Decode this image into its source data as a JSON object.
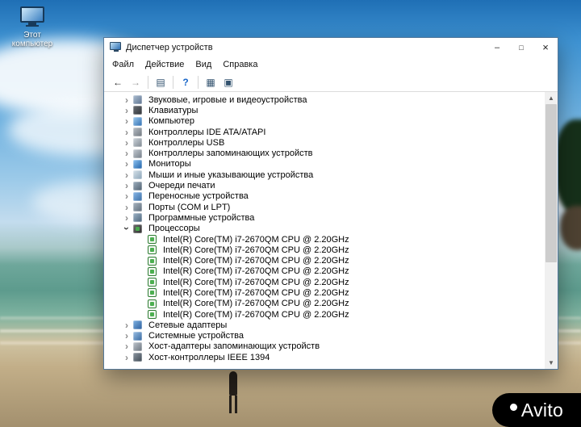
{
  "desktop": {
    "icon_label": "Этот компьютер"
  },
  "watermark": {
    "label": "Avito"
  },
  "window": {
    "title": "Диспетчер устройств",
    "controls": {
      "minimize": "–",
      "maximize": "□",
      "close": "×"
    },
    "menu": [
      "Файл",
      "Действие",
      "Вид",
      "Справка"
    ],
    "toolbar": [
      {
        "name": "back-button",
        "glyph": "←"
      },
      {
        "name": "forward-button",
        "glyph": "→"
      },
      {
        "name": "separator"
      },
      {
        "name": "show-console-tree-button",
        "glyph": "▤"
      },
      {
        "name": "separator"
      },
      {
        "name": "help-button",
        "glyph": "?"
      },
      {
        "name": "separator"
      },
      {
        "name": "properties-button",
        "glyph": "▦"
      },
      {
        "name": "scan-hardware-button",
        "glyph": "▣"
      }
    ],
    "scrollbar": {
      "up_glyph": "▲",
      "down_glyph": "▼"
    },
    "tree": {
      "items": [
        {
          "label": "Звуковые, игровые и видеоустройства",
          "icon": "audio",
          "state": "collapsed"
        },
        {
          "label": "Клавиатуры",
          "icon": "keyboard",
          "state": "collapsed"
        },
        {
          "label": "Компьютер",
          "icon": "computer",
          "state": "collapsed"
        },
        {
          "label": "Контроллеры IDE ATA/ATAPI",
          "icon": "ide",
          "state": "collapsed"
        },
        {
          "label": "Контроллеры USB",
          "icon": "usb",
          "state": "collapsed"
        },
        {
          "label": "Контроллеры запоминающих устройств",
          "icon": "storage",
          "state": "collapsed"
        },
        {
          "label": "Мониторы",
          "icon": "monitor",
          "state": "collapsed"
        },
        {
          "label": "Мыши и иные указывающие устройства",
          "icon": "mouse",
          "state": "collapsed"
        },
        {
          "label": "Очереди печати",
          "icon": "printer",
          "state": "collapsed"
        },
        {
          "label": "Переносные устройства",
          "icon": "portable",
          "state": "collapsed"
        },
        {
          "label": "Порты (COM и LPT)",
          "icon": "ports",
          "state": "collapsed"
        },
        {
          "label": "Программные устройства",
          "icon": "software",
          "state": "collapsed"
        },
        {
          "label": "Процессоры",
          "icon": "cpu",
          "state": "expanded",
          "child_icon": "cpu-child",
          "children": [
            "Intel(R) Core(TM) i7-2670QM CPU @ 2.20GHz",
            "Intel(R) Core(TM) i7-2670QM CPU @ 2.20GHz",
            "Intel(R) Core(TM) i7-2670QM CPU @ 2.20GHz",
            "Intel(R) Core(TM) i7-2670QM CPU @ 2.20GHz",
            "Intel(R) Core(TM) i7-2670QM CPU @ 2.20GHz",
            "Intel(R) Core(TM) i7-2670QM CPU @ 2.20GHz",
            "Intel(R) Core(TM) i7-2670QM CPU @ 2.20GHz",
            "Intel(R) Core(TM) i7-2670QM CPU @ 2.20GHz"
          ]
        },
        {
          "label": "Сетевые адаптеры",
          "icon": "network",
          "state": "collapsed"
        },
        {
          "label": "Системные устройства",
          "icon": "system",
          "state": "collapsed"
        },
        {
          "label": "Хост-адаптеры запоминающих устройств",
          "icon": "host-adapter",
          "state": "collapsed"
        },
        {
          "label": "Хост-контроллеры IEEE 1394",
          "icon": "ieee1394",
          "state": "collapsed"
        }
      ]
    }
  }
}
